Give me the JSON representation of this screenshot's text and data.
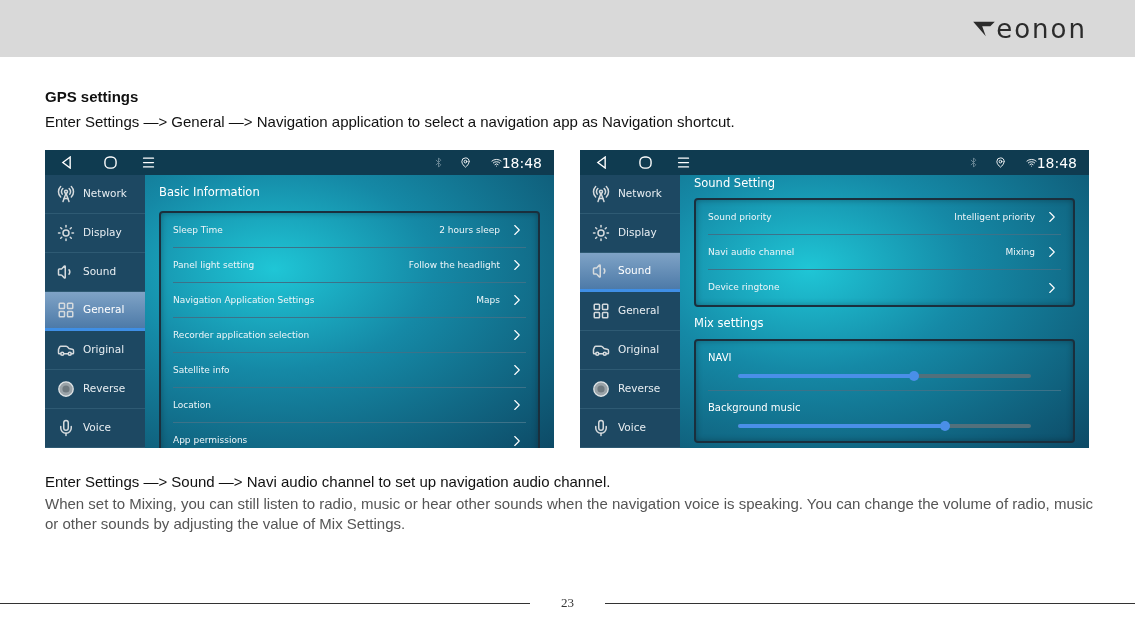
{
  "header": {
    "logo": "eonon"
  },
  "heading": "GPS settings",
  "intro": "Enter Settings —> General —> Navigation application to select a navigation app as Navigation shortcut.",
  "screens": [
    {
      "status_bar": {
        "time": "18:48"
      },
      "sidebar": [
        {
          "label": "Network",
          "selected": false
        },
        {
          "label": "Display",
          "selected": false
        },
        {
          "label": "Sound",
          "selected": false
        },
        {
          "label": "General",
          "selected": true
        },
        {
          "label": "Original",
          "selected": false
        },
        {
          "label": "Reverse",
          "selected": false
        },
        {
          "label": "Voice",
          "selected": false
        }
      ],
      "sections": [
        {
          "title": "Basic Information",
          "kind": "list",
          "items": [
            {
              "label": "Sleep Time",
              "value": "2 hours sleep"
            },
            {
              "label": "Panel light setting",
              "value": "Follow the headlight"
            },
            {
              "label": "Navigation Application Settings",
              "value": "Maps"
            },
            {
              "label": "Recorder application selection"
            },
            {
              "label": "Satellite info"
            },
            {
              "label": "Location"
            },
            {
              "label": "App permissions"
            }
          ]
        }
      ]
    },
    {
      "status_bar": {
        "time": "18:48"
      },
      "sidebar": [
        {
          "label": "Network",
          "selected": false
        },
        {
          "label": "Display",
          "selected": false
        },
        {
          "label": "Sound",
          "selected": true
        },
        {
          "label": "General",
          "selected": false
        },
        {
          "label": "Original",
          "selected": false
        },
        {
          "label": "Reverse",
          "selected": false
        },
        {
          "label": "Voice",
          "selected": false
        }
      ],
      "sections": [
        {
          "title": "Sound Setting",
          "kind": "list",
          "items": [
            {
              "label": "Sound priority",
              "value": "Intelligent priority"
            },
            {
              "label": "Navi audio channel",
              "value": "Mixing"
            },
            {
              "label": "Device ringtone"
            }
          ]
        },
        {
          "title": "Mix settings",
          "kind": "sliders",
          "items": [
            {
              "label": "NAVI",
              "level": 0.6
            },
            {
              "label": "Background music",
              "level": 0.705
            }
          ]
        }
      ]
    }
  ],
  "instruction": "Enter Settings —> Sound —> Navi audio channel to set up navigation audio channel.",
  "description": "When set to Mixing, you can still listen to radio, music or hear other sounds when the navigation voice is speaking. You can change the volume of radio, music or other sounds by adjusting the value of Mix Settings.",
  "page_number": "23"
}
